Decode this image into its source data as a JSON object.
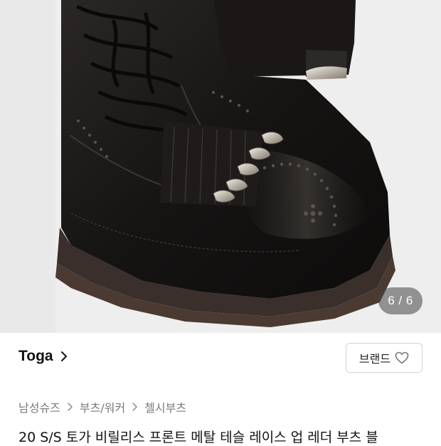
{
  "gallery": {
    "counter": "6 / 6",
    "current": 6,
    "total": 6
  },
  "brand": {
    "name": "Toga",
    "button_label": "브랜드"
  },
  "breadcrumb": [
    {
      "label": "남성슈즈"
    },
    {
      "label": "부츠/워커"
    },
    {
      "label": "첼시부츠"
    }
  ],
  "product": {
    "title": "20 S/S 토가 비릴리스 프론트 메탈 테슬 레이스 업 레더 부츠 블"
  },
  "colors": {
    "accent_border": "#d3d3d3",
    "muted_text": "#7a7a7a",
    "photo_bg": "#f1f1f1"
  },
  "icons": {
    "brand_chevron": "chevron-right-icon",
    "brand_button_icon": "heart-outline-icon",
    "crumb_separator": "chevron-right-icon"
  }
}
